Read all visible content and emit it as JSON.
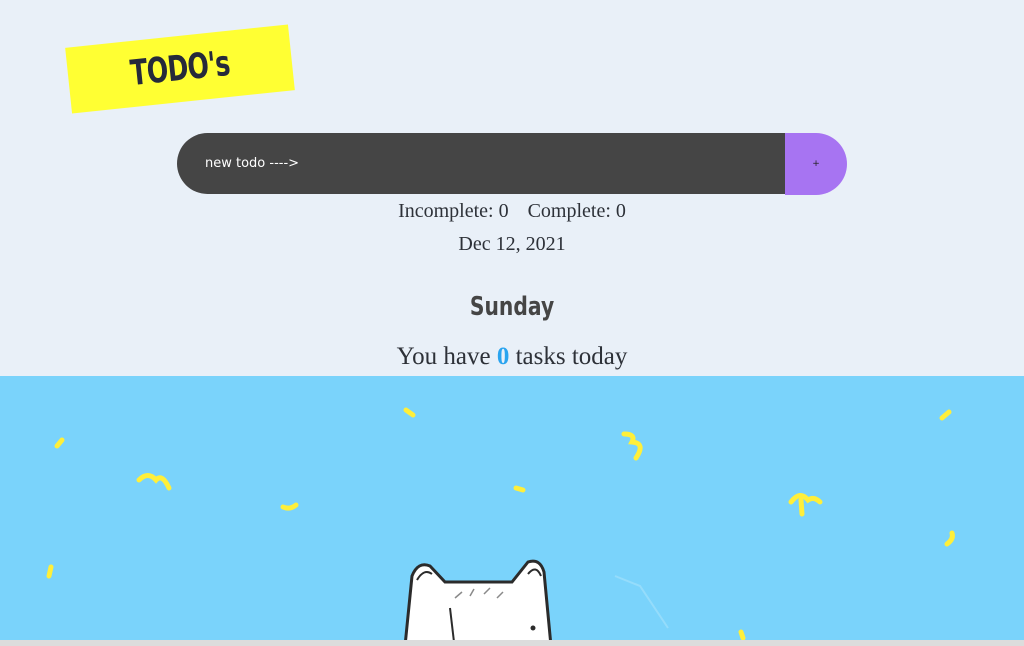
{
  "header": {
    "logo_text": "TODO's"
  },
  "form": {
    "placeholder": "new todo ---->",
    "add_button_label": "+"
  },
  "stats": {
    "incomplete_label": "Incomplete:",
    "incomplete_count": "0",
    "complete_label": "Complete:",
    "complete_count": "0"
  },
  "date": {
    "display": "Dec 12, 2021",
    "weekday": "Sunday"
  },
  "summary": {
    "prefix": "You have",
    "count": "0",
    "suffix": "tasks today"
  },
  "colors": {
    "page_background": "#e9f0f8",
    "logo_background": "#ffff33",
    "input_background": "#454545",
    "add_button": "#a774f2",
    "task_count": "#2aa4ef",
    "scene_background": "#7ad3fb",
    "confetti": "#ffef3a"
  },
  "illustration": {
    "subject": "white cat peeking up with yellow confetti"
  }
}
